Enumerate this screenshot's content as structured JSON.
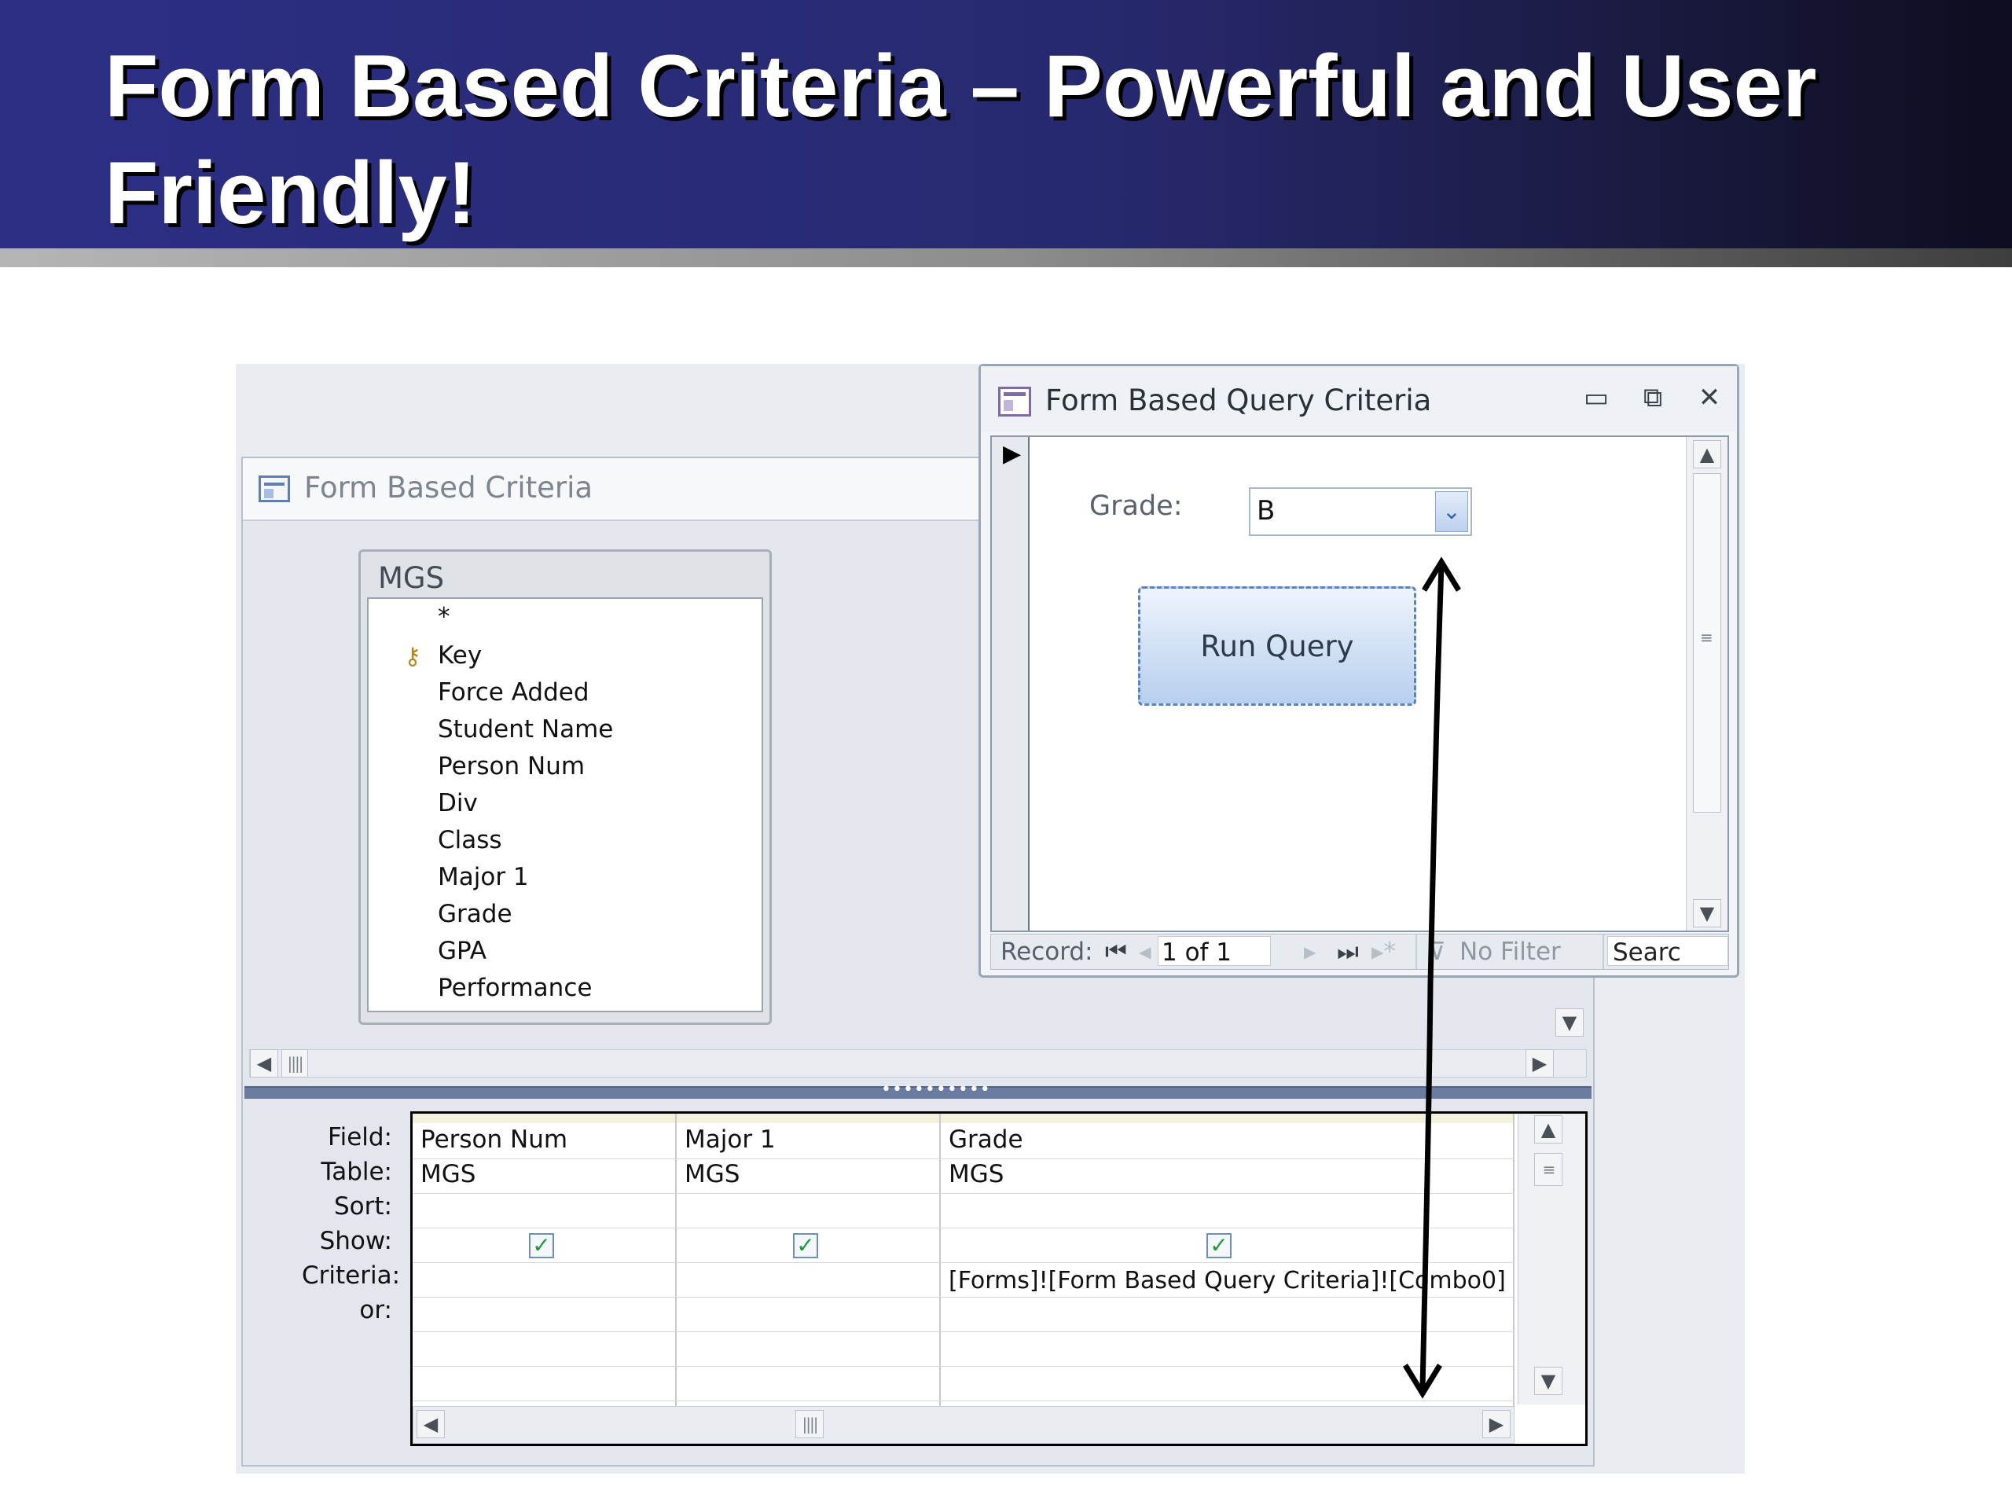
{
  "slide": {
    "title": "Form Based Criteria – Powerful and User Friendly!"
  },
  "query_window": {
    "title": "Form Based Criteria",
    "table": {
      "name": "MGS",
      "fields": [
        "*",
        "Key",
        "Force Added",
        "Student Name",
        "Person Num",
        "Div",
        "Class",
        "Major 1",
        "Grade",
        "GPA",
        "Performance"
      ]
    },
    "grid": {
      "row_labels": [
        "Field:",
        "Table:",
        "Sort:",
        "Show:",
        "Criteria:",
        "or:"
      ],
      "columns": [
        {
          "field": "Person Num",
          "table": "MGS",
          "sort": "",
          "show": true,
          "criteria": ""
        },
        {
          "field": "Major 1",
          "table": "MGS",
          "sort": "",
          "show": true,
          "criteria": ""
        },
        {
          "field": "Grade",
          "table": "MGS",
          "sort": "",
          "show": true,
          "criteria": "[Forms]![Form Based Query Criteria]![Combo0]"
        }
      ]
    }
  },
  "form_window": {
    "title": "Form Based Query Criteria",
    "grade_label": "Grade:",
    "grade_value": "B",
    "run_button": "Run Query",
    "nav": {
      "record_label": "Record:",
      "position": "1 of 1",
      "filter": "No Filter",
      "search": "Searc"
    }
  },
  "icons": {
    "window_form": "form-icon",
    "window_query": "query-icon",
    "key": "key-icon",
    "minimize": "minimize-icon",
    "restore": "restore-icon",
    "close": "close-icon",
    "dropdown": "chevron-down-icon"
  },
  "colors": {
    "banner": "#2c2f84",
    "checkbox": "#1f9b35",
    "accent": "#5d83bd"
  }
}
